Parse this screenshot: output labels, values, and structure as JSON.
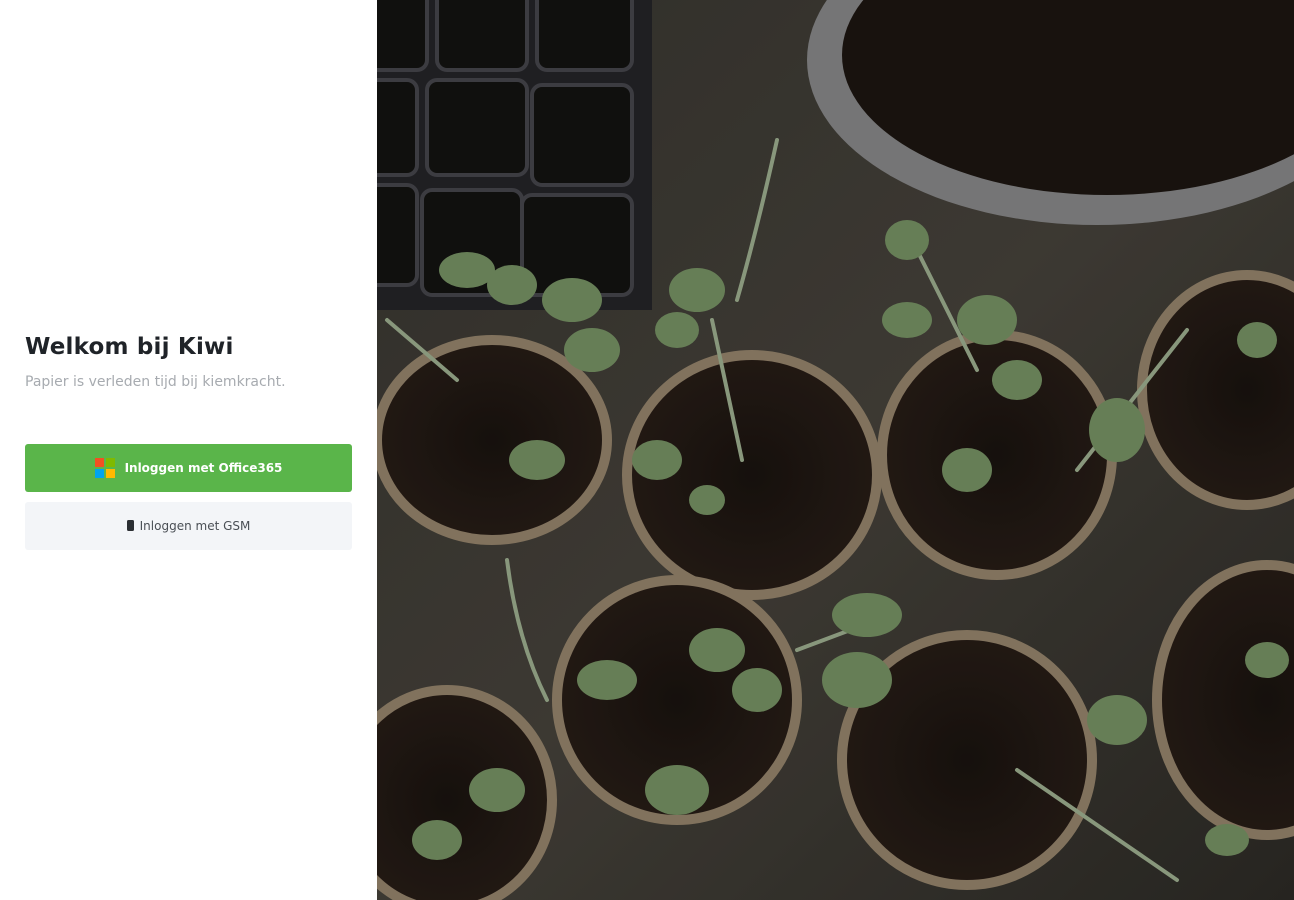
{
  "login": {
    "title": "Welkom bij Kiwi",
    "subtitle": "Papier is verleden tijd bij kiemkracht.",
    "office_button_label": "Inloggen met Office365",
    "gsm_button_label": "Inloggen met GSM"
  },
  "icons": {
    "office": "office365-icon",
    "gsm": "mobile-phone-icon"
  },
  "colors": {
    "accent_green": "#5ab54a",
    "secondary_button_bg": "#f3f5f8",
    "title": "#1f2328",
    "subtitle": "#a7abb0"
  }
}
